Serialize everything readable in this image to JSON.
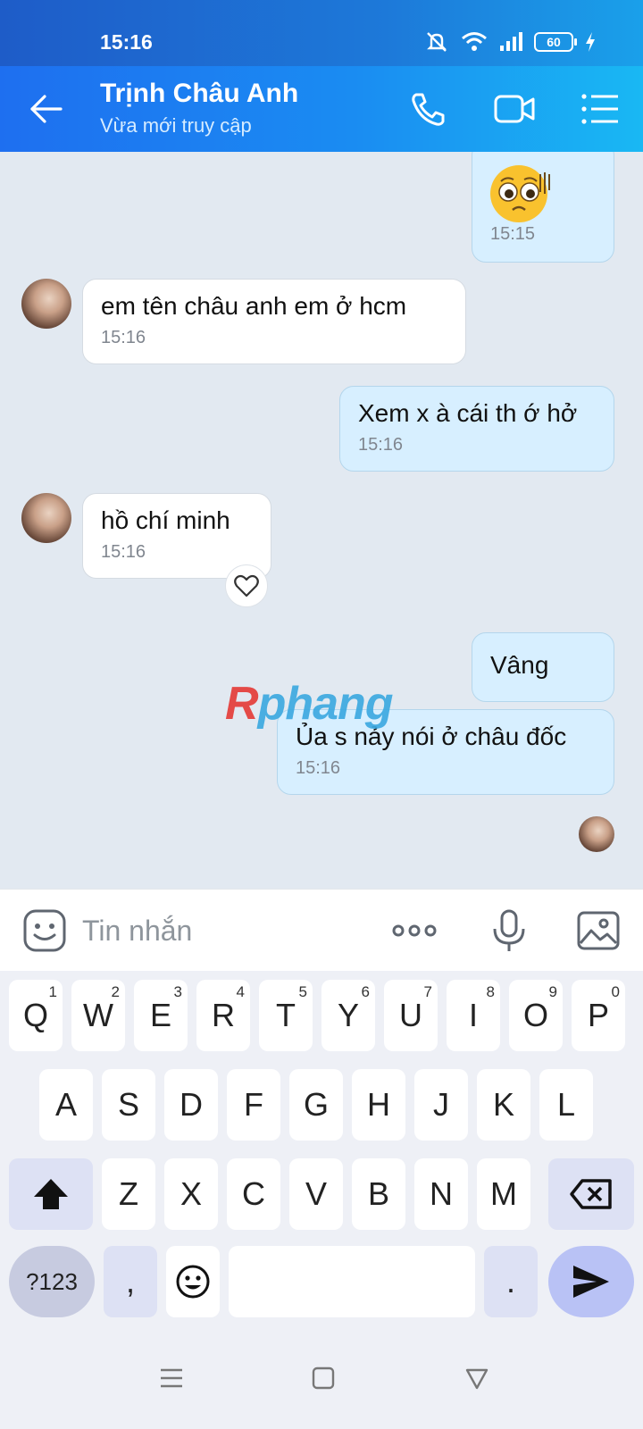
{
  "status_bar": {
    "time": "15:16",
    "battery": "60"
  },
  "header": {
    "contact_name": "Trịnh Châu Anh",
    "contact_status": "Vừa mới truy cập"
  },
  "messages": [
    {
      "direction": "out",
      "type": "sticker",
      "time": "15:15"
    },
    {
      "direction": "in",
      "text": "em tên châu anh em ở hcm",
      "time": "15:16"
    },
    {
      "direction": "out",
      "text": "Xem x à cái th ớ hở",
      "time": "15:16"
    },
    {
      "direction": "in",
      "text": "hồ chí minh",
      "time": "15:16"
    },
    {
      "direction": "out",
      "text": "Vâng",
      "time": ""
    },
    {
      "direction": "out",
      "text": "Ủa s nảy nói ở châu đốc",
      "time": "15:16"
    }
  ],
  "watermark": {
    "r": "R",
    "rest": "phang"
  },
  "composer": {
    "placeholder": "Tin nhắn"
  },
  "keyboard": {
    "row1": [
      {
        "key": "Q",
        "hint": "1"
      },
      {
        "key": "W",
        "hint": "2"
      },
      {
        "key": "E",
        "hint": "3"
      },
      {
        "key": "R",
        "hint": "4"
      },
      {
        "key": "T",
        "hint": "5"
      },
      {
        "key": "Y",
        "hint": "6"
      },
      {
        "key": "U",
        "hint": "7"
      },
      {
        "key": "I",
        "hint": "8"
      },
      {
        "key": "O",
        "hint": "9"
      },
      {
        "key": "P",
        "hint": "0"
      }
    ],
    "row2": [
      "A",
      "S",
      "D",
      "F",
      "G",
      "H",
      "J",
      "K",
      "L"
    ],
    "row3": [
      "Z",
      "X",
      "C",
      "V",
      "B",
      "N",
      "M"
    ],
    "symbols_key": "?123",
    "comma_key": ",",
    "period_key": "."
  }
}
